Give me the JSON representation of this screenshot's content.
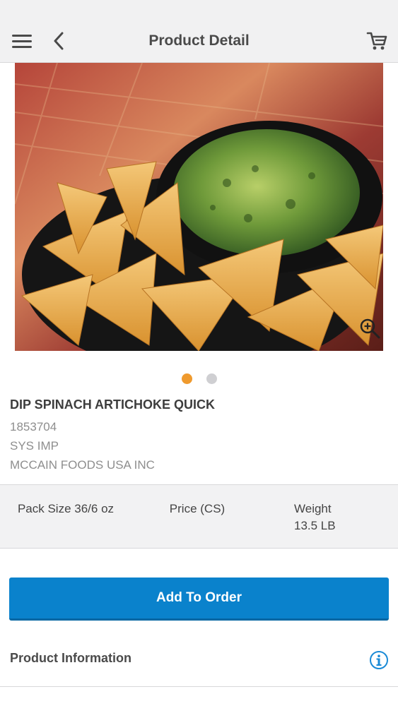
{
  "header": {
    "title": "Product Detail",
    "menu_icon": "hamburger-menu-icon",
    "back_icon": "chevron-left-icon",
    "cart_icon": "shopping-cart-icon"
  },
  "gallery": {
    "image_alt": "spinach artichoke dip with tortilla chips",
    "zoom_icon": "zoom-in-icon",
    "active_index": 0,
    "count": 2
  },
  "product": {
    "name": "DIP SPINACH ARTICHOKE QUICK",
    "sku": "1853704",
    "brand": "SYS IMP",
    "manufacturer": "MCCAIN FOODS USA INC"
  },
  "specs": {
    "pack_size": "Pack Size 36/6 oz",
    "price": "Price (CS)",
    "weight_label": "Weight",
    "weight_value": "13.5 LB"
  },
  "actions": {
    "add_to_order": "Add To Order"
  },
  "info": {
    "label": "Product Information",
    "icon": "info-icon"
  },
  "colors": {
    "accent": "#0a82cc",
    "active_dot": "#ef9a2e",
    "info_icon": "#1a8ad6"
  }
}
